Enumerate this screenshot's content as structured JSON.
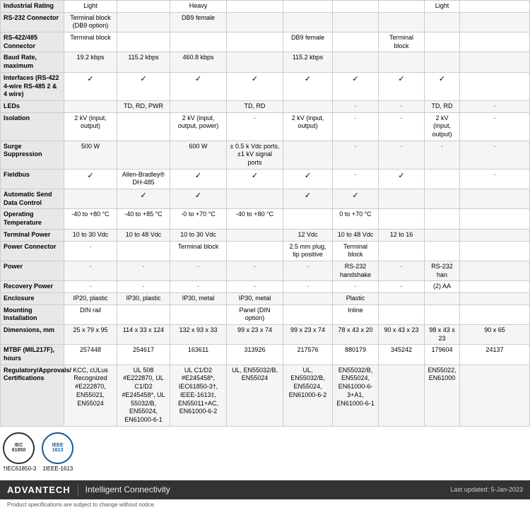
{
  "table": {
    "rows": [
      {
        "label": "Industrial Rating",
        "cells": [
          "Light",
          "",
          "Heavy",
          "",
          "",
          "",
          "",
          "Light",
          ""
        ]
      },
      {
        "label": "RS-232 Connector",
        "cells": [
          "Terminal block (DB9 option)",
          "",
          "DB9 female",
          "",
          "",
          "",
          "",
          "",
          ""
        ]
      },
      {
        "label": "RS-422/485 Connector",
        "cells": [
          "Terminal block",
          "",
          "",
          "",
          "DB9 female",
          "",
          "Terminal block",
          "",
          ""
        ]
      },
      {
        "label": "Baud Rate, maximum",
        "cells": [
          "19.2 kbps",
          "115.2 kbps",
          "460.8 kbps",
          "",
          "115.2 kbps",
          "",
          "",
          "",
          ""
        ]
      },
      {
        "label": "Interfaces (RS-422 4-wire RS-485 2 & 4 wire)",
        "cells": [
          "✓",
          "✓",
          "✓",
          "✓",
          "✓",
          "✓",
          "✓",
          "✓",
          ""
        ]
      },
      {
        "label": "LEDs",
        "cells": [
          "",
          "TD, RD, PWR",
          "",
          "TD, RD",
          "",
          "-",
          "-",
          "TD, RD",
          "-"
        ]
      },
      {
        "label": "Isolation",
        "cells": [
          "2 kV (input, output)",
          "",
          "2 kV (input, output, power)",
          "-",
          "2 kV (input, output)",
          "-",
          "-",
          "2 kV (input, output)",
          "-"
        ]
      },
      {
        "label": "Surge Suppression",
        "cells": [
          "500 W",
          "",
          "600 W",
          "± 0.5 k Vdc ports, ±1 kV signal ports",
          "",
          "-",
          "-",
          "-",
          "-"
        ]
      },
      {
        "label": "Fieldbus",
        "cells": [
          "✓",
          "Allen-Bradley® DH-485",
          "✓",
          "✓",
          "✓",
          "-",
          "✓",
          "",
          "-"
        ]
      },
      {
        "label": "Automatic Send Data Control",
        "cells": [
          "",
          "✓",
          "✓",
          "",
          "✓",
          "✓",
          "",
          "",
          ""
        ]
      },
      {
        "label": "Operating Temperature",
        "cells": [
          "-40 to +80 °C",
          "-40 to +85 °C",
          "-0 to +70 °C",
          "-40 to +80 °C",
          "",
          "0 to +70 °C",
          "",
          "",
          ""
        ]
      },
      {
        "label": "Terminal Power",
        "cells": [
          "10 to 30 Vdc",
          "10 to 48 Vdc",
          "10 to 30 Vdc",
          "",
          "12 Vdc",
          "10 to 48 Vdc",
          "12 to 16",
          "",
          ""
        ]
      },
      {
        "label": "Power Connector",
        "cells": [
          "-",
          "",
          "Terminal block",
          "",
          "2.5 mm plug, tip positive",
          "Terminal block",
          "",
          "",
          ""
        ]
      },
      {
        "label": "Power",
        "cells": [
          "-",
          "-",
          "-",
          "-",
          "-",
          "RS-232 handshake",
          "-",
          "RS-232 han",
          ""
        ]
      },
      {
        "label": "Recovery Power",
        "cells": [
          "-",
          "-",
          "-",
          "-",
          "-",
          "-",
          "-",
          "(2) AA",
          ""
        ]
      },
      {
        "label": "Enclosure",
        "cells": [
          "IP20, plastic",
          "IP30, plastic",
          "IP30, metal",
          "IP30, metal",
          "",
          "Plastic",
          "",
          "",
          ""
        ]
      },
      {
        "label": "Mounting Installation",
        "cells": [
          "DIN rail",
          "",
          "",
          "Panel (DIN option)",
          "",
          "Inline",
          "",
          "",
          ""
        ]
      },
      {
        "label": "Dimensions, mm",
        "cells": [
          "25 x 79 x 95",
          "114 x 33 x 124",
          "132 x 93 x 33",
          "99 x 23 x 74",
          "99 x 23 x 74",
          "78 x 43 x 20",
          "90 x 43 x 23",
          "98 x 43 x 23",
          "90 x 65"
        ]
      },
      {
        "label": "MTBF (MIL217F), hours",
        "cells": [
          "257448",
          "254617",
          "163611",
          "313926",
          "217576",
          "880179",
          "345242",
          "179604",
          "24137"
        ]
      },
      {
        "label": "Regulatory/Approvals/ Certifications",
        "cells": [
          "KCC, cULus Recognized #E222870, EN55021, EN55024",
          "UL 508 #E222870, UL C1/D2 #E245458*, UL 55032/B, EN55024, EN61000-6-1",
          "UL C1/D2 #E245458*, IEC61850-3†, IEEE-1613‡, EN55011+AC, EN61000-6-2",
          "UL, EN55032/B, EN55024",
          "UL, EN55032/B, EN55024, EN61000-6-2",
          "EN55032/B, EN55024, EN61000-6-3+A1, EN61000-6-1",
          "",
          "EN55022, EN61000",
          ""
        ]
      }
    ]
  },
  "certifications": [
    {
      "id": "iec61850",
      "label": "†IEC61850-3",
      "text": "IEC\n61850"
    },
    {
      "id": "ieee1613",
      "label": "‡IEEE-1613",
      "text": "IEEE\n1613"
    }
  ],
  "footer": {
    "brand": "ADVANTECH",
    "tagline": "Intelligent Connectivity",
    "notice": "Product specifications are subject to change without notice.",
    "date_label": "Last updated: 5-Jan-2023"
  }
}
